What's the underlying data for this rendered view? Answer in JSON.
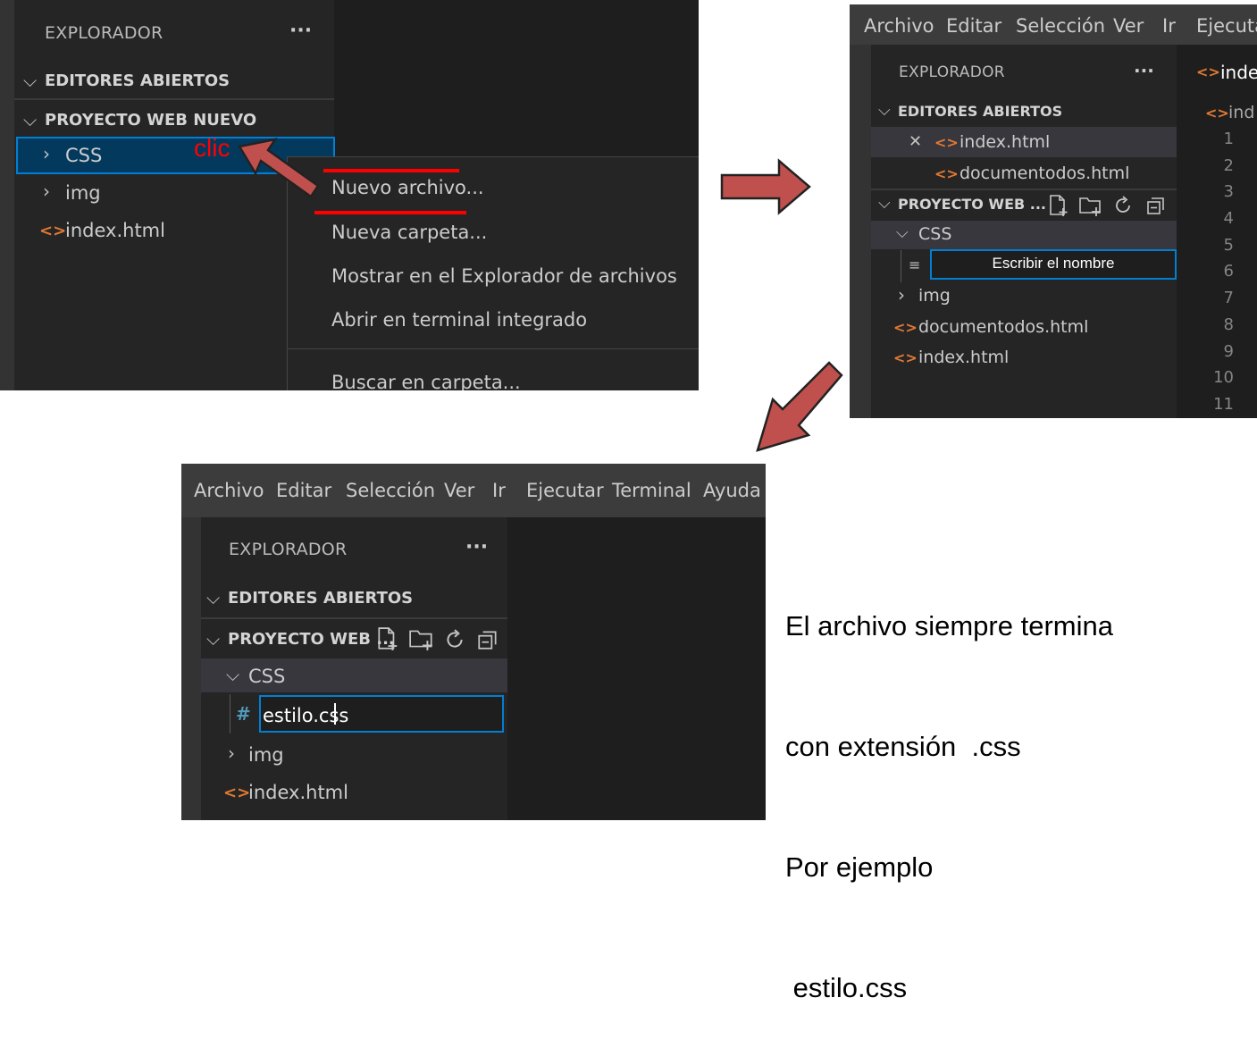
{
  "panel1": {
    "explorer_title": "EXPLORADOR",
    "more": "···",
    "open_editors": "EDITORES ABIERTOS",
    "project": "PROYECTO WEB NUEVO",
    "tree": {
      "css": "CSS",
      "img": "img",
      "index": "index.html"
    },
    "click_label": "clic",
    "context_menu": {
      "new_file": "Nuevo archivo...",
      "new_folder": "Nueva carpeta...",
      "reveal": "Mostrar en el Explorador de archivos",
      "terminal": "Abrir en terminal integrado",
      "search": "Buscar en carpeta..."
    }
  },
  "panel2": {
    "menubar": [
      "Archivo",
      "Editar",
      "Selección",
      "Ver",
      "Ir",
      "Ejecutar"
    ],
    "explorer_title": "EXPLORADOR",
    "more": "···",
    "open_editors": "EDITORES ABIERTOS",
    "open_files": [
      "index.html",
      "documentodos.html"
    ],
    "project": "PROYECTO WEB ...",
    "tree": {
      "css": "CSS",
      "new_file_placeholder": "Escribir el nombre",
      "img": "img",
      "doc": "documentodos.html",
      "index": "index.html"
    },
    "tab_label": "inde",
    "breadcrumb": "ind",
    "line_numbers": [
      "1",
      "2",
      "3",
      "4",
      "5",
      "6",
      "7",
      "8",
      "9",
      "10",
      "11"
    ]
  },
  "panel3": {
    "menubar": [
      "Archivo",
      "Editar",
      "Selección",
      "Ver",
      "Ir",
      "Ejecutar",
      "Terminal",
      "Ayuda"
    ],
    "explorer_title": "EXPLORADOR",
    "more": "···",
    "open_editors": "EDITORES ABIERTOS",
    "project": "PROYECTO WEB ...",
    "tree": {
      "css": "CSS",
      "new_file_value": "estilo.css",
      "img": "img",
      "index": "index.html"
    }
  },
  "caption": {
    "line1": "El archivo siempre termina",
    "line2": "con extensión  .css",
    "line3": "Por ejemplo",
    "line4": " estilo.css"
  },
  "colors": {
    "sidebar": "#252526",
    "editor": "#1e1e1e",
    "menubar": "#3c3c3c",
    "selection": "#37373d",
    "focus_border": "#007fd4",
    "arrow_fill": "#c0504d",
    "annotation_red": "#ff0000",
    "html_icon": "#e37933",
    "css_icon": "#519aba"
  }
}
